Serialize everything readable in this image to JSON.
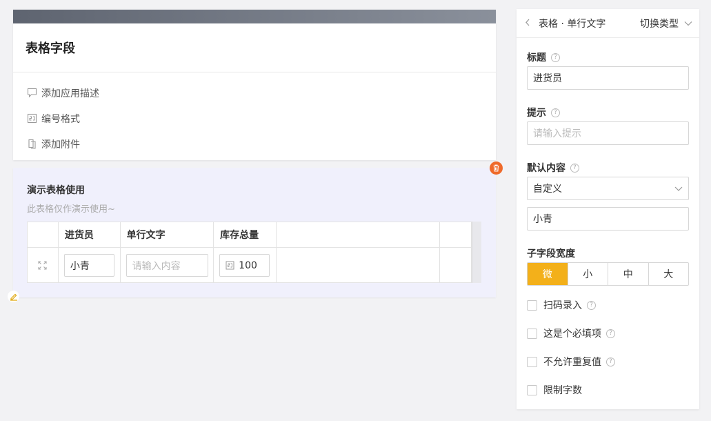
{
  "form": {
    "title": "表格字段",
    "actions": [
      {
        "label": "添加应用描述",
        "icon": "comment-icon"
      },
      {
        "label": "编号格式",
        "icon": "number-format-icon"
      },
      {
        "label": "添加附件",
        "icon": "attachment-icon"
      }
    ]
  },
  "table_field": {
    "title": "演示表格使用",
    "description": "此表格仅作演示使用~",
    "columns": [
      "进货员",
      "单行文字",
      "库存总量"
    ],
    "row": {
      "purchaser": "小青",
      "text_placeholder": "请输入内容",
      "stock": "100"
    }
  },
  "panel": {
    "breadcrumb": "表格 · 单行文字",
    "switch_type": "切换类型",
    "title_label": "标题",
    "title_value": "进货员",
    "hint_label": "提示",
    "hint_placeholder": "请输入提示",
    "default_label": "默认内容",
    "default_mode": "自定义",
    "default_value": "小青",
    "width_label": "子字段宽度",
    "width_options": [
      "微",
      "小",
      "中",
      "大"
    ],
    "width_selected": "微",
    "checkboxes": [
      {
        "label": "扫码录入",
        "help": true
      },
      {
        "label": "这是个必填项",
        "help": true
      },
      {
        "label": "不允许重复值",
        "help": true
      },
      {
        "label": "限制字数",
        "help": false
      }
    ]
  },
  "colors": {
    "accent": "#f3b01a",
    "delete": "#ef6a2a",
    "banner": "#6b717c"
  }
}
